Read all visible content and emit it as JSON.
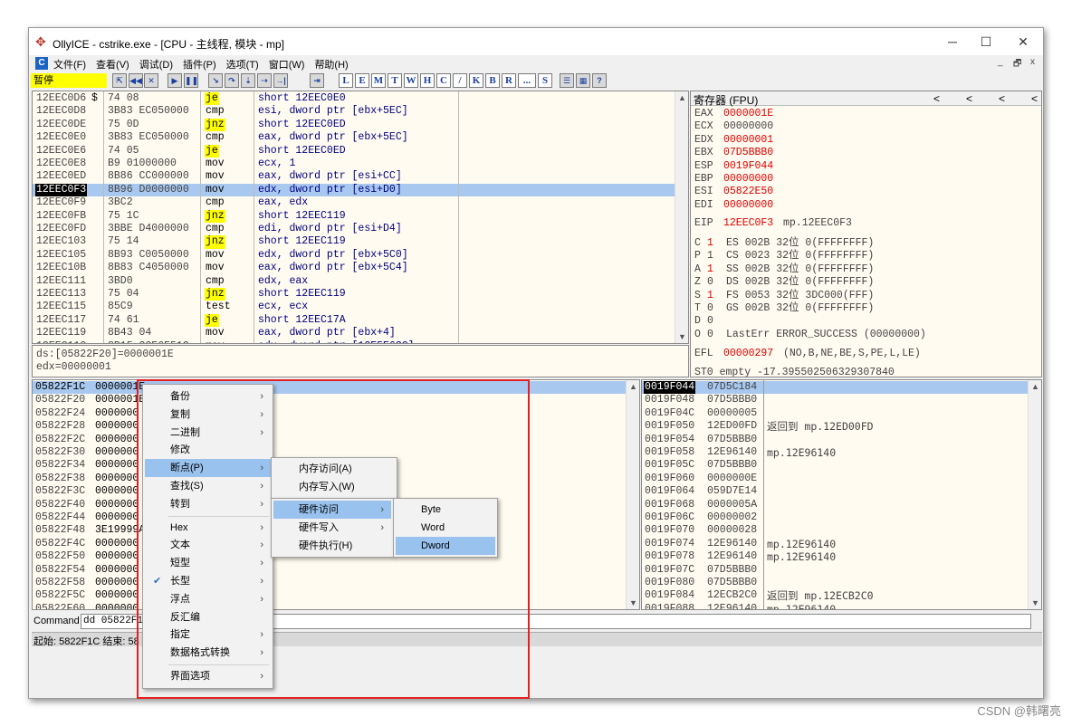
{
  "window": {
    "title": "OllyICE - cstrike.exe - [CPU -  主线程, 模块 - mp]",
    "minimize_icon": "─",
    "maximize_icon": "☐",
    "close_icon": "✕"
  },
  "menubar": {
    "items": [
      "文件(F)",
      "查看(V)",
      "调试(D)",
      "插件(P)",
      "选项(T)",
      "窗口(W)",
      "帮助(H)"
    ],
    "mdi": [
      "_",
      "🗗",
      "x"
    ]
  },
  "toolbar": {
    "status": "暂停",
    "letters": [
      "L",
      "E",
      "M",
      "T",
      "W",
      "H",
      "C",
      "/",
      "K",
      "B",
      "R",
      "...",
      "S"
    ]
  },
  "disasm": {
    "rows": [
      {
        "addr": "12EEC0D6",
        "m": "$",
        "hex": "74 08",
        "mn": "je",
        "op": "short 12EEC0E0"
      },
      {
        "addr": "12EEC0D8",
        "m": "",
        "hex": "3B83 EC050000",
        "mn": "cmp",
        "op": "esi, dword ptr [ebx+5EC]"
      },
      {
        "addr": "12EEC0DE",
        "m": "",
        "hex": "75 0D",
        "mn": "jnz",
        "op": "short 12EEC0ED"
      },
      {
        "addr": "12EEC0E0",
        "m": "",
        "hex": "3B83 EC050000",
        "mn": "cmp",
        "op": "eax, dword ptr [ebx+5EC]"
      },
      {
        "addr": "12EEC0E6",
        "m": "",
        "hex": "74 05",
        "mn": "je",
        "op": "short 12EEC0ED"
      },
      {
        "addr": "12EEC0E8",
        "m": "",
        "hex": "B9 01000000",
        "mn": "mov",
        "op": "ecx, 1"
      },
      {
        "addr": "12EEC0ED",
        "m": "",
        "hex": "8B86 CC000000",
        "mn": "mov",
        "op": "eax, dword ptr [esi+CC]"
      },
      {
        "addr": "12EEC0F3",
        "m": "",
        "hex": "8B96 D0000000",
        "mn": "mov",
        "op": "edx, dword ptr [esi+D0]"
      },
      {
        "addr": "12EEC0F9",
        "m": "",
        "hex": "3BC2",
        "mn": "cmp",
        "op": "eax, edx"
      },
      {
        "addr": "12EEC0FB",
        "m": "",
        "hex": "75 1C",
        "mn": "jnz",
        "op": "short 12EEC119"
      },
      {
        "addr": "12EEC0FD",
        "m": "",
        "hex": "3BBE D4000000",
        "mn": "cmp",
        "op": "edi, dword ptr [esi+D4]"
      },
      {
        "addr": "12EEC103",
        "m": "",
        "hex": "75 14",
        "mn": "jnz",
        "op": "short 12EEC119"
      },
      {
        "addr": "12EEC105",
        "m": "",
        "hex": "8B93 C0050000",
        "mn": "mov",
        "op": "edx, dword ptr [ebx+5C0]"
      },
      {
        "addr": "12EEC10B",
        "m": "",
        "hex": "8B83 C4050000",
        "mn": "mov",
        "op": "eax, dword ptr [ebx+5C4]"
      },
      {
        "addr": "12EEC111",
        "m": "",
        "hex": "3BD0",
        "mn": "cmp",
        "op": "edx, eax"
      },
      {
        "addr": "12EEC113",
        "m": "",
        "hex": "75 04",
        "mn": "jnz",
        "op": "short 12EEC119"
      },
      {
        "addr": "12EEC115",
        "m": "",
        "hex": "85C9",
        "mn": "test",
        "op": "ecx, ecx"
      },
      {
        "addr": "12EEC117",
        "m": "",
        "hex": "74 61",
        "mn": "je",
        "op": "short 12EEC17A"
      },
      {
        "addr": "12EEC119",
        "m": "",
        "hex": "8B43 04",
        "mn": "mov",
        "op": "eax, dword ptr [ebx+4]"
      },
      {
        "addr": "12EEC11C",
        "m": "",
        "hex": "8B15 3CE6E512",
        "mn": "mov",
        "op": "edx, dword ptr [12E5E63C]"
      }
    ],
    "info1": "ds:[05822F20]=0000001E",
    "info2": "edx=00000001"
  },
  "registers": {
    "header": "寄存器 (FPU)",
    "nav": [
      "<",
      "<",
      "<",
      "<"
    ],
    "gp": [
      {
        "name": "EAX",
        "val": "0000001E",
        "red": true
      },
      {
        "name": "ECX",
        "val": "00000000",
        "red": false
      },
      {
        "name": "EDX",
        "val": "00000001",
        "red": true
      },
      {
        "name": "EBX",
        "val": "07D5BBB0",
        "red": true
      },
      {
        "name": "ESP",
        "val": "0019F044",
        "red": true
      },
      {
        "name": "EBP",
        "val": "00000000",
        "red": true
      },
      {
        "name": "ESI",
        "val": "05822E50",
        "red": true
      },
      {
        "name": "EDI",
        "val": "00000000",
        "red": true
      }
    ],
    "eip": {
      "name": "EIP",
      "val": "12EEC0F3",
      "comment": "mp.12EEC0F3"
    },
    "flags": [
      {
        "f": "C",
        "v": "1",
        "seg": "ES 002B 32位 0(FFFFFFFF)",
        "red": true
      },
      {
        "f": "P",
        "v": "1",
        "seg": "CS 0023 32位 0(FFFFFFFF)",
        "red": false
      },
      {
        "f": "A",
        "v": "1",
        "seg": "SS 002B 32位 0(FFFFFFFF)",
        "red": true
      },
      {
        "f": "Z",
        "v": "0",
        "seg": "DS 002B 32位 0(FFFFFFFF)",
        "red": false
      },
      {
        "f": "S",
        "v": "1",
        "seg": "FS 0053 32位 3DC000(FFF)",
        "red": true
      },
      {
        "f": "T",
        "v": "0",
        "seg": "GS 002B 32位 0(FFFFFFFF)",
        "red": false
      },
      {
        "f": "D",
        "v": "0",
        "seg": "",
        "red": false
      },
      {
        "f": "O",
        "v": "0",
        "seg": "LastErr ERROR_SUCCESS (00000000)",
        "red": false
      }
    ],
    "efl": {
      "name": "EFL",
      "val": "00000297",
      "desc": "(NO,B,NE,BE,S,PE,L,LE)"
    },
    "st0": "ST0 empty -17.395502506329307840"
  },
  "dump": {
    "rows": [
      {
        "addr": "05822F1C",
        "val": "0000001E"
      },
      {
        "addr": "05822F20",
        "val": "0000001E"
      },
      {
        "addr": "05822F24",
        "val": "0000000"
      },
      {
        "addr": "05822F28",
        "val": "0000000"
      },
      {
        "addr": "05822F2C",
        "val": "0000000"
      },
      {
        "addr": "05822F30",
        "val": "0000000"
      },
      {
        "addr": "05822F34",
        "val": "0000000"
      },
      {
        "addr": "05822F38",
        "val": "0000000"
      },
      {
        "addr": "05822F3C",
        "val": "0000000"
      },
      {
        "addr": "05822F40",
        "val": "0000000"
      },
      {
        "addr": "05822F44",
        "val": "0000000"
      },
      {
        "addr": "05822F48",
        "val": "3E19999A"
      },
      {
        "addr": "05822F4C",
        "val": "0000000"
      },
      {
        "addr": "05822F50",
        "val": "0000000"
      },
      {
        "addr": "05822F54",
        "val": "0000000"
      },
      {
        "addr": "05822F58",
        "val": "0000000"
      },
      {
        "addr": "05822F5C",
        "val": "0000000"
      },
      {
        "addr": "05822F60",
        "val": "0000000"
      }
    ]
  },
  "stack": {
    "rows": [
      {
        "addr": "0019F044",
        "val": "07D5C184",
        "comment": ""
      },
      {
        "addr": "0019F048",
        "val": "07D5BBB0",
        "comment": ""
      },
      {
        "addr": "0019F04C",
        "val": "00000005",
        "comment": ""
      },
      {
        "addr": "0019F050",
        "val": "12ED00FD",
        "comment": "返回到 mp.12ED00FD"
      },
      {
        "addr": "0019F054",
        "val": "07D5BBB0",
        "comment": ""
      },
      {
        "addr": "0019F058",
        "val": "12E96140",
        "comment": "mp.12E96140"
      },
      {
        "addr": "0019F05C",
        "val": "07D5BBB0",
        "comment": ""
      },
      {
        "addr": "0019F060",
        "val": "0000000E",
        "comment": ""
      },
      {
        "addr": "0019F064",
        "val": "059D7E14",
        "comment": ""
      },
      {
        "addr": "0019F068",
        "val": "0000005A",
        "comment": ""
      },
      {
        "addr": "0019F06C",
        "val": "00000002",
        "comment": ""
      },
      {
        "addr": "0019F070",
        "val": "00000028",
        "comment": ""
      },
      {
        "addr": "0019F074",
        "val": "12E96140",
        "comment": "mp.12E96140"
      },
      {
        "addr": "0019F078",
        "val": "12E96140",
        "comment": "mp.12E96140"
      },
      {
        "addr": "0019F07C",
        "val": "07D5BBB0",
        "comment": ""
      },
      {
        "addr": "0019F080",
        "val": "07D5BBB0",
        "comment": ""
      },
      {
        "addr": "0019F084",
        "val": "12ECB2C0",
        "comment": "返回到 mp.12ECB2C0"
      },
      {
        "addr": "0019F088",
        "val": "12E96140",
        "comment": "mp.12E96140"
      }
    ]
  },
  "command": {
    "label": "Command",
    "value": "dd 05822F1C"
  },
  "statusbar": {
    "text": "起始: 5822F1C  结束: 58"
  },
  "context_menu": {
    "items": [
      {
        "label": "备份",
        "sub": true
      },
      {
        "label": "复制",
        "sub": true
      },
      {
        "label": "二进制",
        "sub": true
      },
      {
        "label": "修改",
        "sub": false
      },
      {
        "label": "断点(P)",
        "sub": true,
        "active": true
      },
      {
        "label": "查找(S)",
        "sub": true
      },
      {
        "label": "转到",
        "sub": true
      },
      {
        "label": "Hex",
        "sub": true,
        "sep_before": true
      },
      {
        "label": "文本",
        "sub": true
      },
      {
        "label": "短型",
        "sub": true
      },
      {
        "label": "长型",
        "sub": true,
        "checked": true
      },
      {
        "label": "浮点",
        "sub": true
      },
      {
        "label": "反汇编",
        "sub": false
      },
      {
        "label": "指定",
        "sub": true
      },
      {
        "label": "数据格式转换",
        "sub": true
      },
      {
        "label": "界面选项",
        "sub": true,
        "sep_before": true
      }
    ],
    "breakpoint_sub": [
      "内存访问(A)",
      "内存写入(W)"
    ],
    "hw_sub": [
      {
        "label": "硬件访问",
        "sub": true,
        "active": true
      },
      {
        "label": "硬件写入",
        "sub": true
      },
      {
        "label": "硬件执行(H)",
        "sub": false
      }
    ],
    "size_sub": [
      {
        "label": "Byte",
        "active": false
      },
      {
        "label": "Word",
        "active": false
      },
      {
        "label": "Dword",
        "active": true
      }
    ]
  },
  "watermark": "CSDN @韩曙亮"
}
